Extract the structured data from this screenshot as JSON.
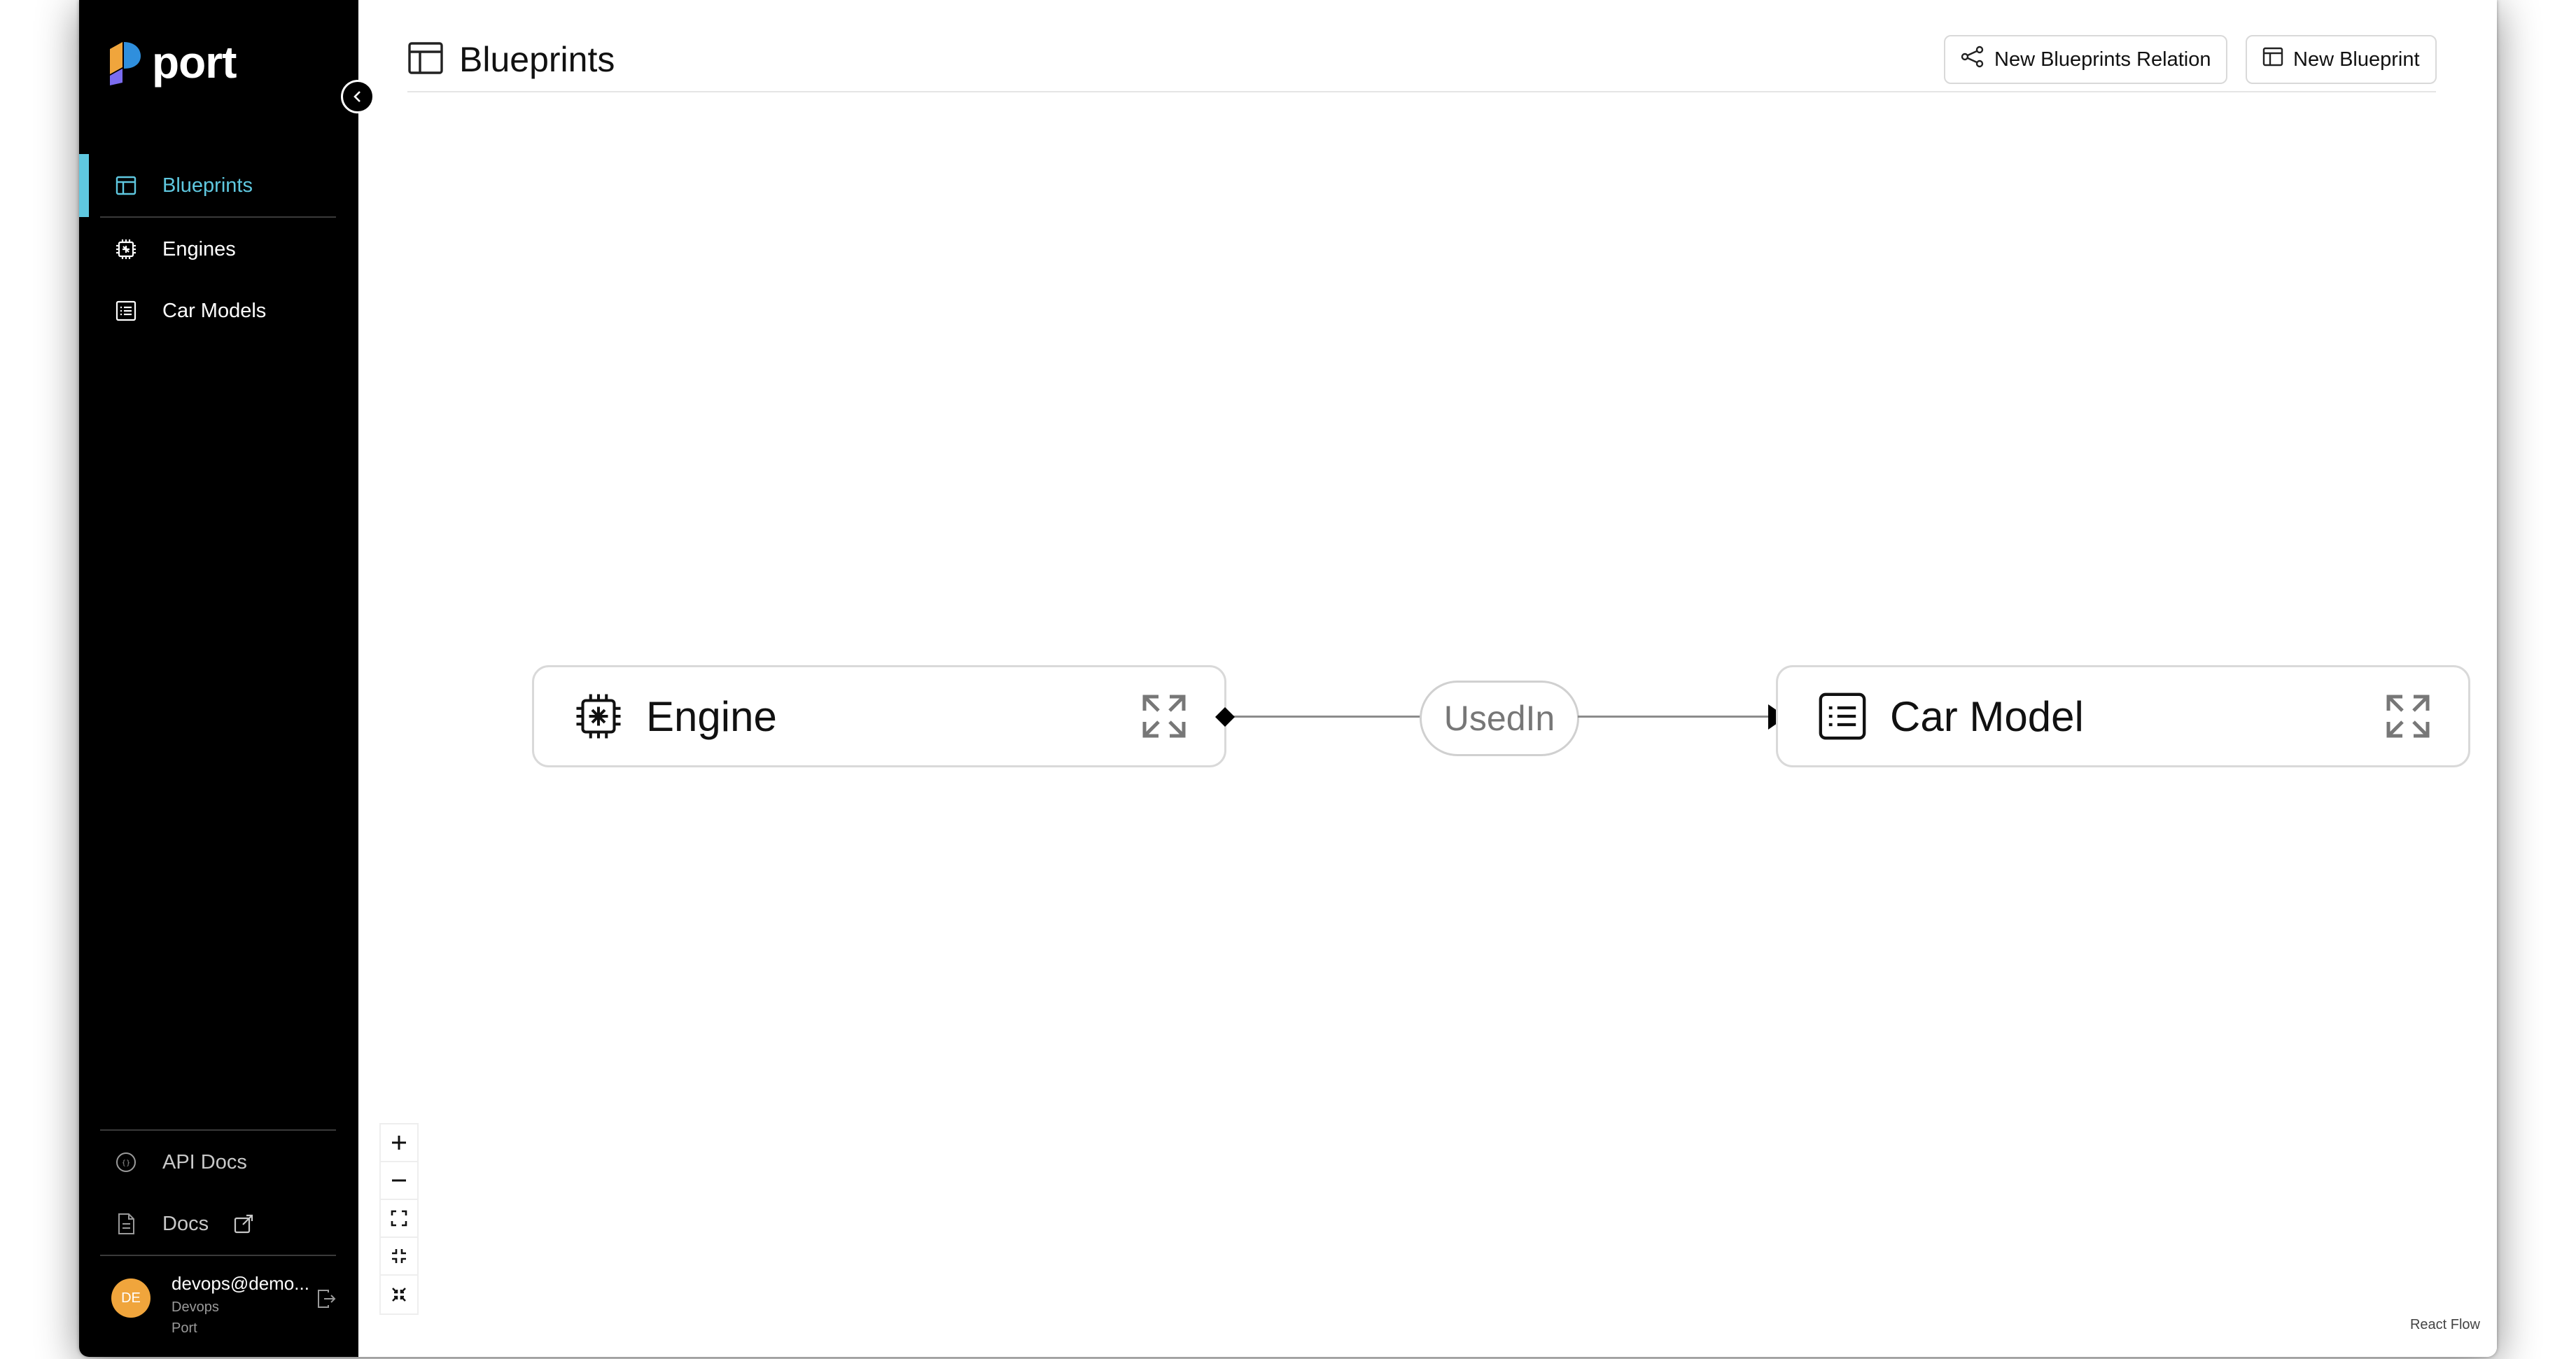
{
  "app": {
    "logo_text": "port"
  },
  "sidebar": {
    "items": [
      {
        "label": "Blueprints",
        "icon": "layout-icon",
        "active": true
      },
      {
        "label": "Engines",
        "icon": "cpu-icon",
        "active": false
      },
      {
        "label": "Car Models",
        "icon": "list-icon",
        "active": false
      }
    ],
    "bottom_items": [
      {
        "label": "API Docs",
        "icon": "api-icon"
      },
      {
        "label": "Docs",
        "icon": "document-icon",
        "external_icon": "external-link-icon"
      }
    ],
    "user": {
      "initials": "DE",
      "email": "devops@demo...",
      "role": "Devops",
      "org": "Port"
    }
  },
  "header": {
    "title": "Blueprints",
    "new_relation_label": "New Blueprints Relation",
    "new_blueprint_label": "New Blueprint"
  },
  "graph": {
    "nodes": [
      {
        "label": "Engine",
        "icon": "cpu-icon"
      },
      {
        "label": "Car Model",
        "icon": "list-icon"
      }
    ],
    "edge_label": "UsedIn"
  },
  "footer": {
    "attribution": "React Flow"
  },
  "colors": {
    "accent": "#5fc8e0",
    "sidebar_bg": "#000000",
    "avatar": "#f0a53c"
  }
}
